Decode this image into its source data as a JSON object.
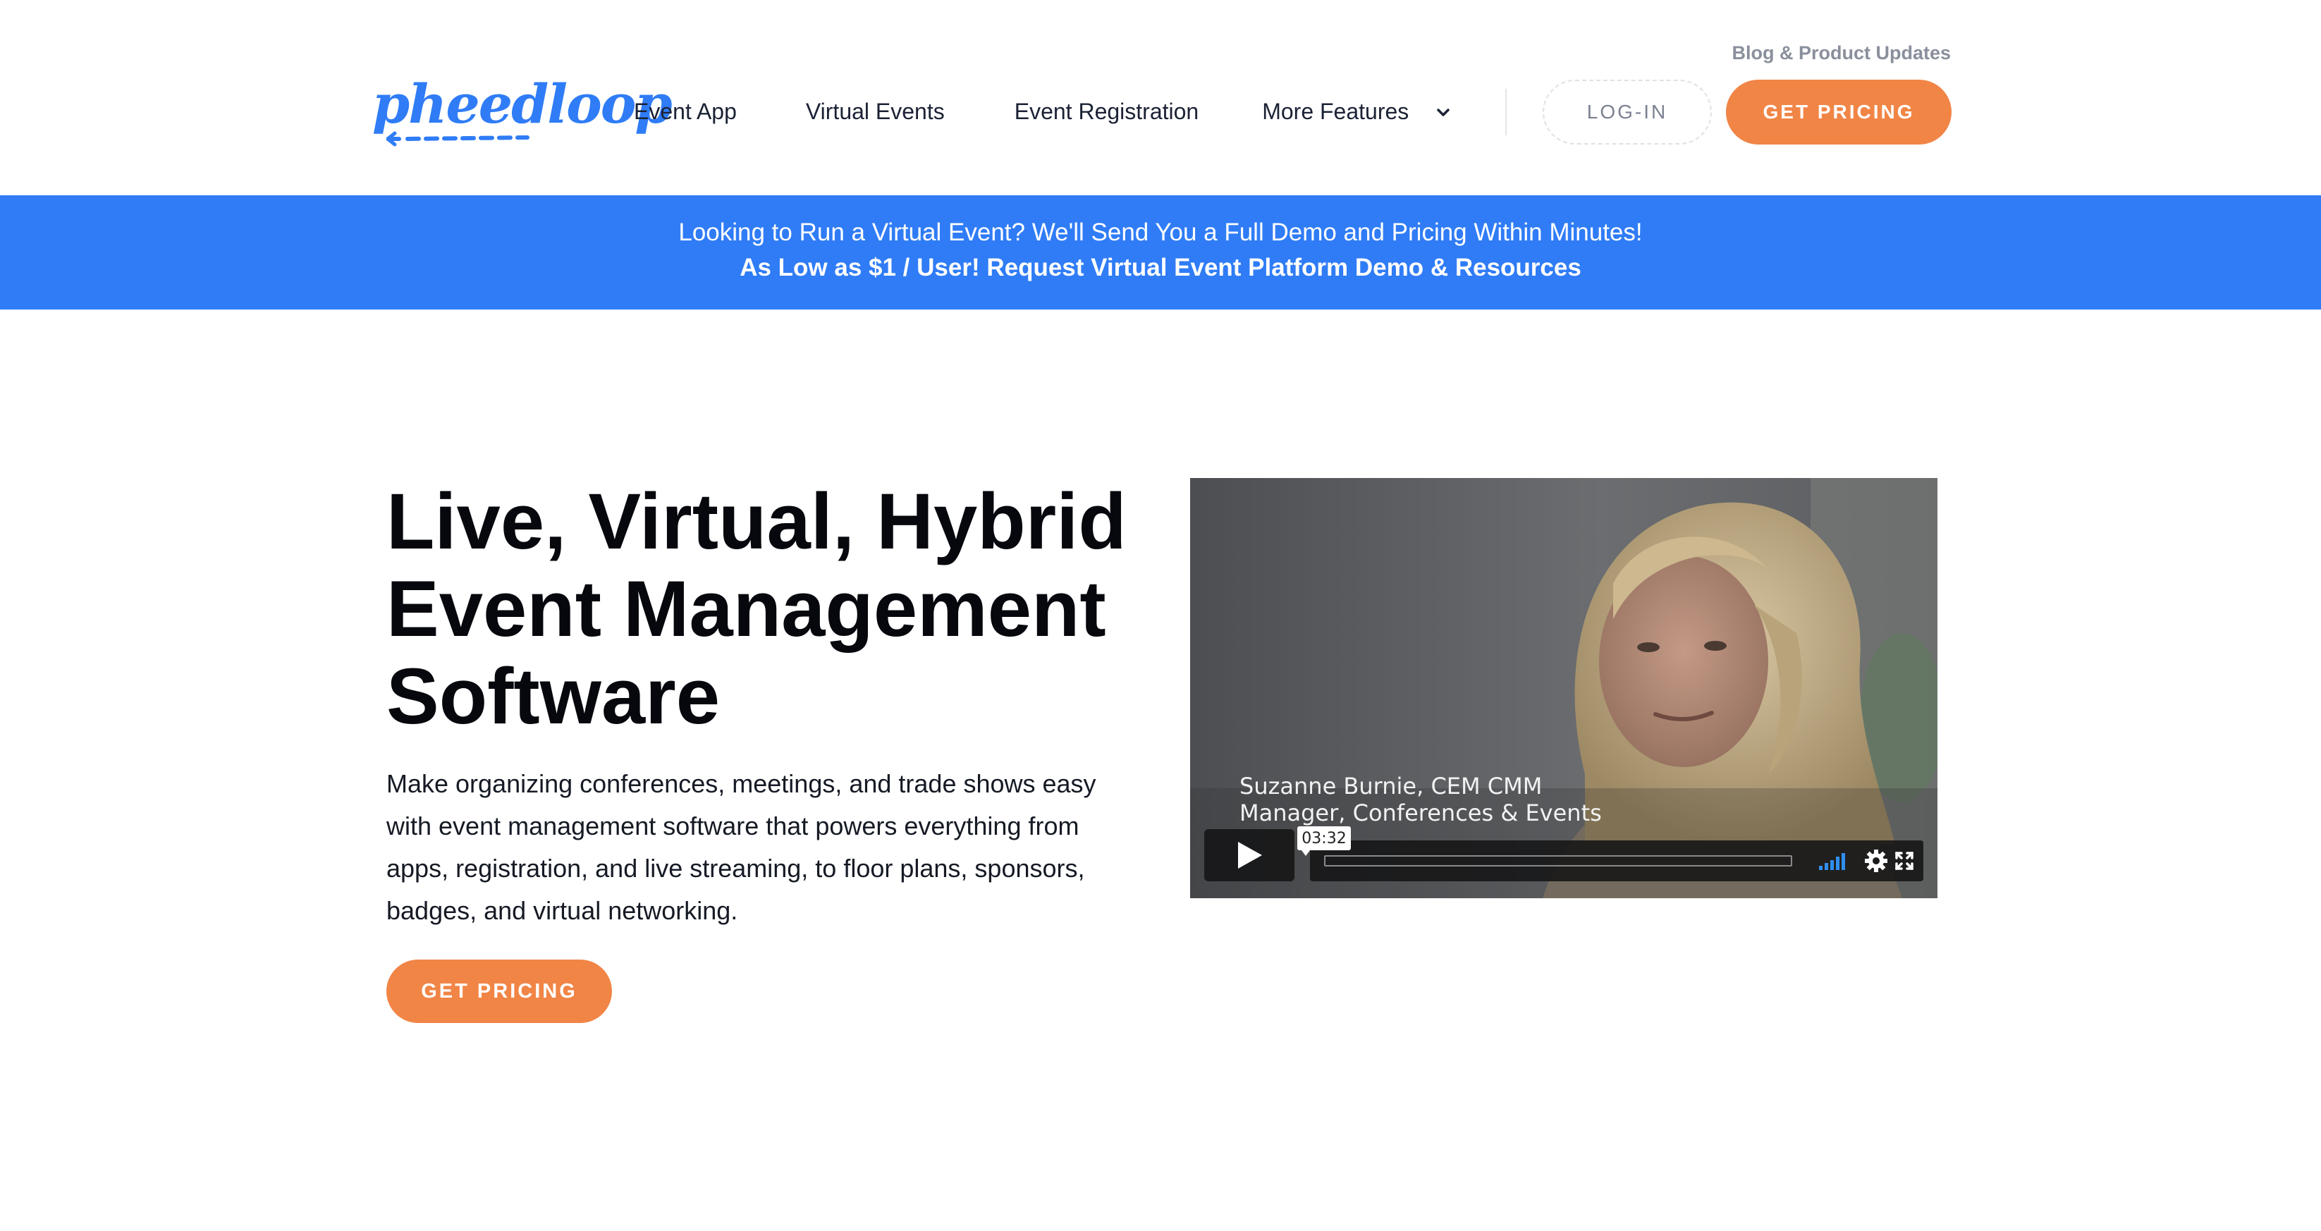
{
  "header": {
    "logo_text": "pheedloop",
    "nav": [
      {
        "label": "Event App"
      },
      {
        "label": "Virtual Events"
      },
      {
        "label": "Event Registration"
      },
      {
        "label": "More Features",
        "icon": "chevron-down-icon"
      }
    ],
    "blog_link": "Blog & Product Updates",
    "login_label": "LOG-IN",
    "pricing_label": "GET PRICING"
  },
  "banner": {
    "line1": "Looking to Run a Virtual Event? We'll Send You a Full Demo and Pricing Within Minutes!",
    "line2": "As Low as $1 / User! Request Virtual Event Platform Demo & Resources"
  },
  "hero": {
    "title_lines": [
      "Live, Virtual, Hybrid",
      "Event Management",
      "Software"
    ],
    "description_lines": [
      "Make organizing conferences, meetings, and trade shows easy",
      "with event management software that powers everything from",
      "apps, registration, and live streaming, to floor plans, sponsors,",
      "badges, and virtual networking."
    ],
    "cta_label": "GET PRICING"
  },
  "video": {
    "caption_name": "Suzanne Burnie, CEM CMM",
    "caption_role": "Manager, Conferences & Events",
    "duration": "03:32",
    "progress": 0.0,
    "icons": [
      "play-icon",
      "volume-icon",
      "gear-icon",
      "fullscreen-icon"
    ]
  },
  "colors": {
    "brand_blue": "#2f7cf6",
    "accent_orange": "#f18546",
    "text_dark": "#06080d"
  }
}
